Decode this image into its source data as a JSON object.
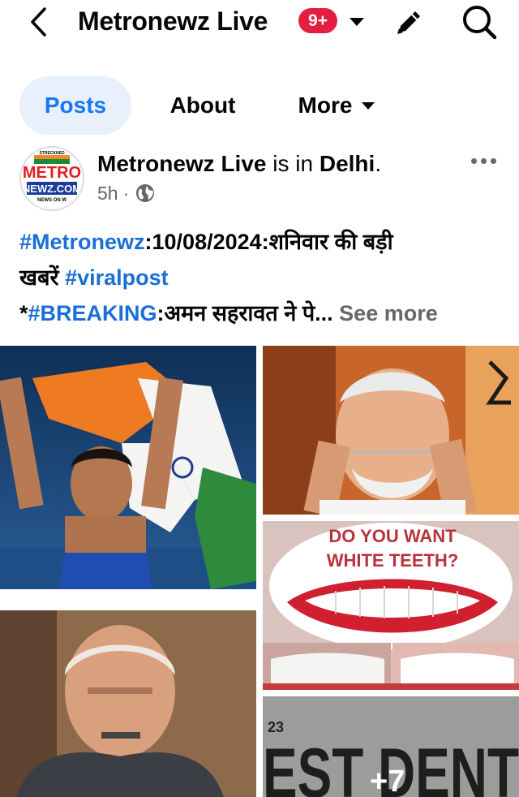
{
  "header": {
    "page_name": "Metronewz Live",
    "notification_count": "9+",
    "icons": {
      "back": "back-arrow-icon",
      "caret": "caret-down-icon",
      "edit": "pencil-icon",
      "search": "search-icon"
    }
  },
  "tabs": [
    {
      "label": "Posts",
      "active": true
    },
    {
      "label": "About",
      "active": false
    },
    {
      "label": "More",
      "active": false
    }
  ],
  "post": {
    "author": "Metronewz Live",
    "location_prefix": "is in",
    "location": "Delhi",
    "location_suffix": ".",
    "time": "5h",
    "meta_separator": "·",
    "privacy_icon": "globe-icon",
    "avatar_logo": {
      "top_text": "METRO",
      "bottom_text": "NEWZ.COM",
      "arc_top": "STRECKNED",
      "arc_bottom": "NEWS ON W"
    },
    "text": {
      "line1_tag": "#Metronewz",
      "line1_rest": ":10/08/2024:शनिवार की बड़ी",
      "line2_text": "खबरें ",
      "line2_tag": "#viralpost",
      "line3_prefix": "*",
      "line3_tag": "#BREAKING",
      "line3_rest": ":अमन सहरावत ने पे...",
      "see_more": "See more"
    },
    "photos": {
      "teeth_caption_line1": "DO YOU WANT",
      "teeth_caption_line2": "WHITE TEETH?",
      "sign_number": "23",
      "sign_text": "EST DENT",
      "more_count": "+7"
    }
  },
  "colors": {
    "accent": "#1877f2",
    "hashtag": "#1a6fd6",
    "badge": "#e41e3f",
    "active_tab_bg": "#e7f0fb",
    "muted_text": "#65676b"
  }
}
